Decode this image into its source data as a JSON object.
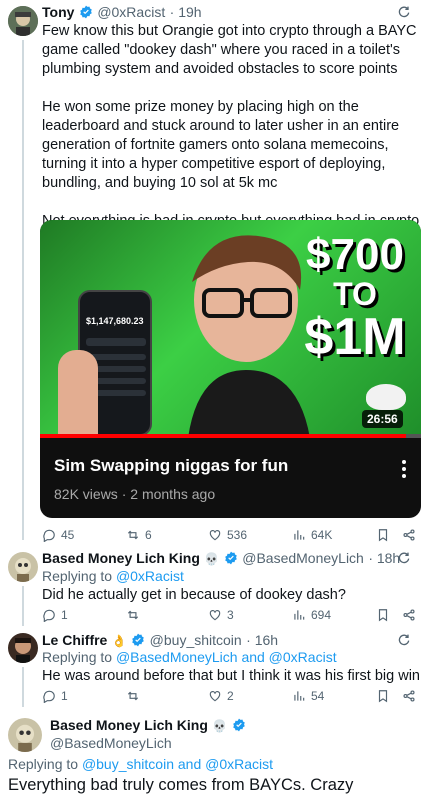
{
  "tweet1": {
    "name": "Tony",
    "handle": "@0xRacist",
    "time": "· 19h",
    "paragraphs": [
      "Few know this but Orangie got into crypto through a BAYC game called \"dookey dash\" where you raced in a toilet's plumbing system and avoided obstacles to score points",
      "He won some prize money by placing high on the leaderboard and stuck around to later usher in an entire generation of fortnite gamers onto solana memecoins, turning it into a hyper competitive esport of deploying, bundling, and buying 10 sol at 5k mc",
      "Not everything is bad in crypto but everything bad in crypto always traces back to the apes..."
    ],
    "video": {
      "headline_top": "$700",
      "headline_mid": "TO",
      "headline_bottom": "$1M",
      "phone_balance": "$1,147,680.23",
      "duration": "26:56",
      "title": "Sim Swapping niggas for fun",
      "views": "82K views",
      "ago": "2 months ago"
    },
    "stats": {
      "replies": "45",
      "reposts": "6",
      "likes": "536",
      "views": "64K"
    }
  },
  "tweet2": {
    "name": "Based Money Lich King",
    "skull": "💀",
    "handle": "@BasedMoneyLich",
    "time": "· 18h",
    "replying_prefix": "Replying to",
    "replying_to": "@0xRacist",
    "text": "Did he actually get in because of dookey dash?",
    "stats": {
      "replies": "1",
      "reposts": "",
      "likes": "3",
      "views": "694"
    }
  },
  "tweet3": {
    "name": "Le Chiffre",
    "hand": "👌",
    "handle": "@buy_shitcoin",
    "time": "· 16h",
    "replying_prefix": "Replying to",
    "replying_to": "@BasedMoneyLich and @0xRacist",
    "text": "He was around before that but I think it was his first big win",
    "stats": {
      "replies": "1",
      "reposts": "",
      "likes": "2",
      "views": "54"
    }
  },
  "tweet4": {
    "name": "Based Money Lich King",
    "skull": "💀",
    "handle": "@BasedMoneyLich",
    "replying_prefix": "Replying to",
    "replying_to": "@buy_shitcoin and @0xRacist",
    "text": "Everything bad truly comes from BAYCs. Crazy"
  },
  "colors": {
    "accent": "#1d9bf0",
    "muted": "#536471",
    "green": "#2fbf3a",
    "progress_red": "#ff0000"
  }
}
